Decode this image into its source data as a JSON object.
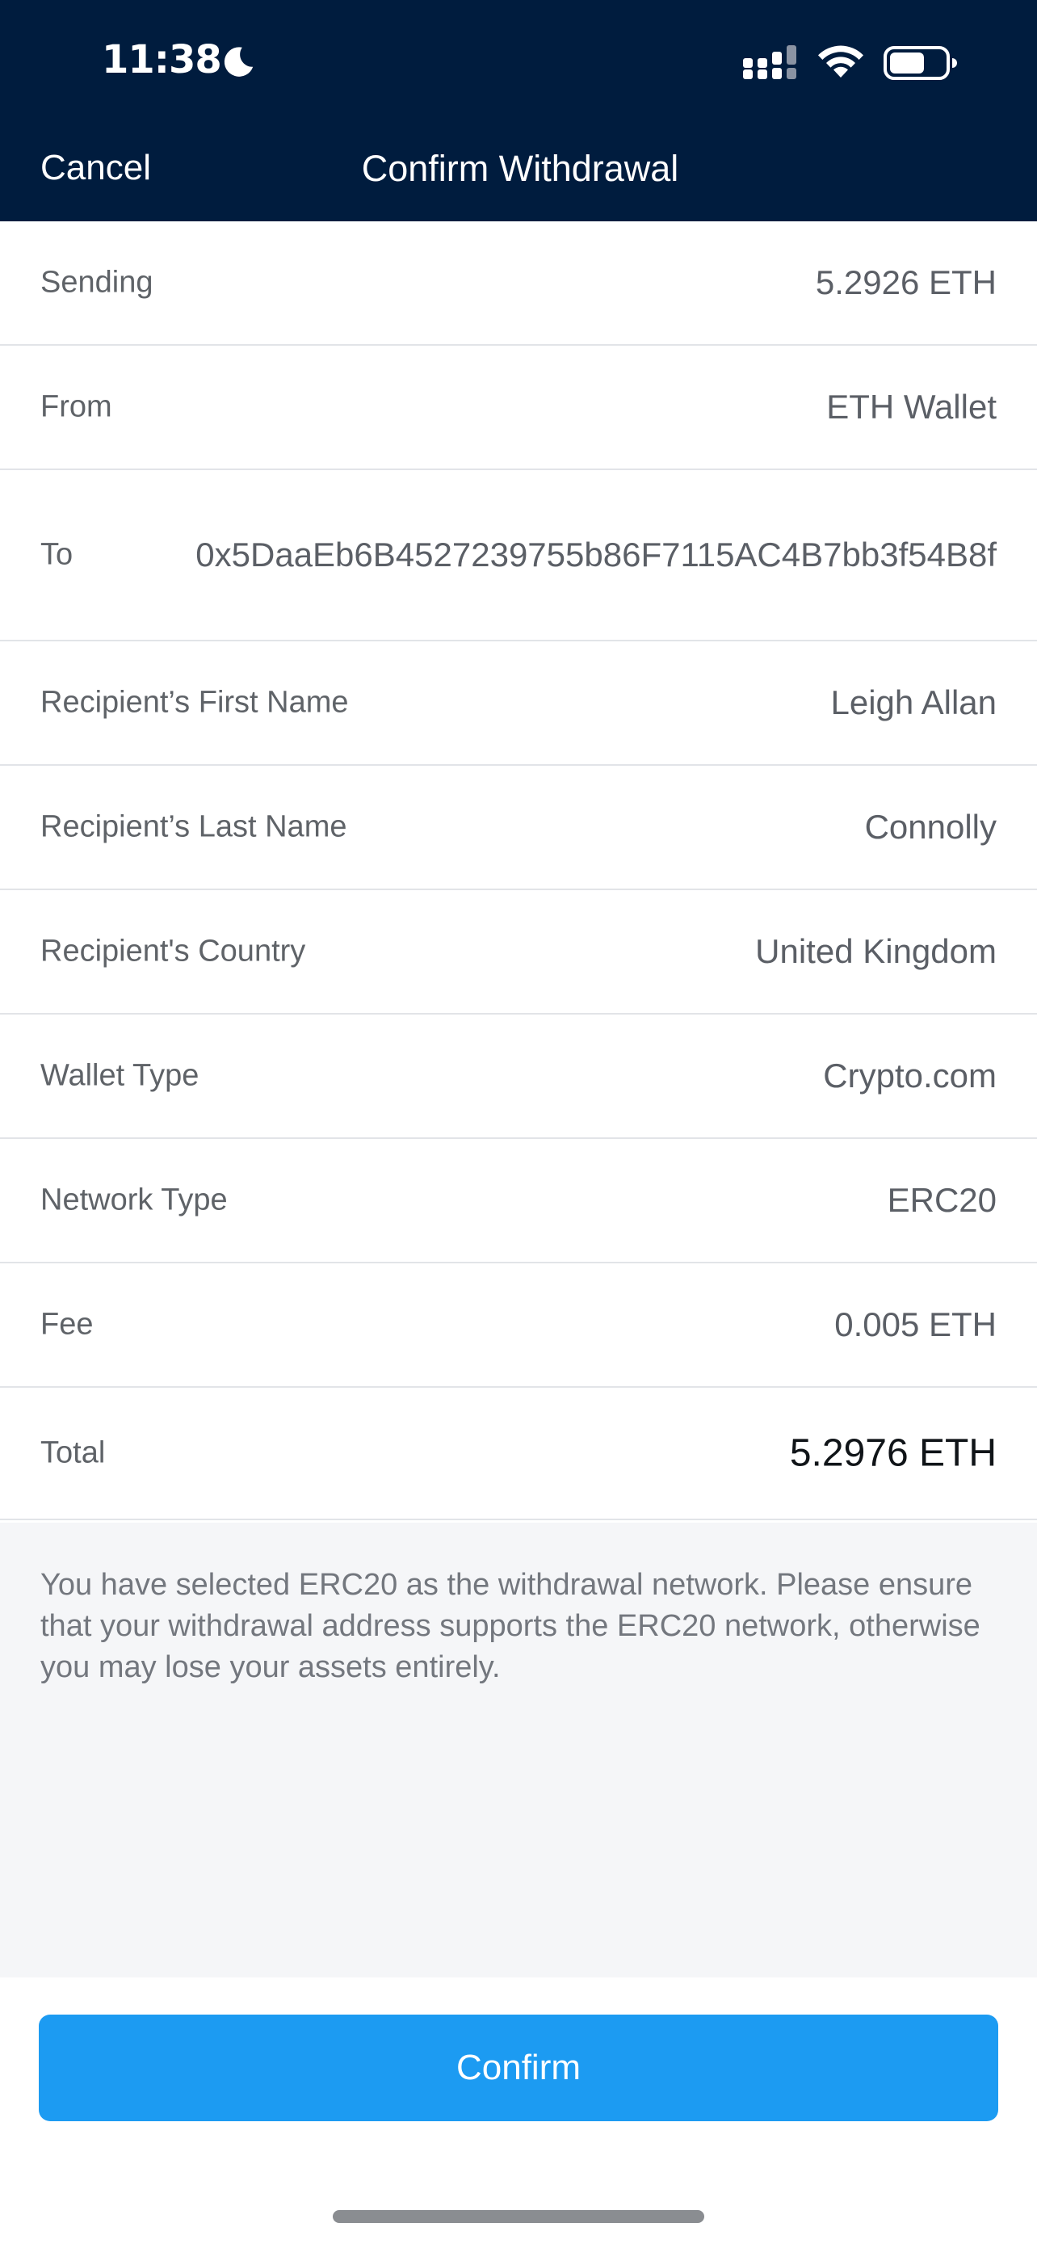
{
  "status_bar": {
    "time": "11:38",
    "icons": [
      "moon-icon",
      "signal-icon",
      "wifi-icon",
      "battery-icon"
    ]
  },
  "nav": {
    "cancel_label": "Cancel",
    "title": "Confirm Withdrawal"
  },
  "rows": [
    {
      "label": "Sending",
      "value": "5.2926 ETH"
    },
    {
      "label": "From",
      "value": "ETH Wallet"
    },
    {
      "label": "To",
      "value": "0x5DaaEb6B4527239755b86F7115AC4B7bb3f54B8f"
    },
    {
      "label": "Recipient’s First Name",
      "value": "Leigh Allan"
    },
    {
      "label": "Recipient’s Last Name",
      "value": "Connolly"
    },
    {
      "label": "Recipient's Country",
      "value": "United Kingdom"
    },
    {
      "label": "Wallet Type",
      "value": "Crypto.com"
    },
    {
      "label": "Network Type",
      "value": "ERC20"
    },
    {
      "label": "Fee",
      "value": "0.005 ETH"
    },
    {
      "label": "Total",
      "value": "5.2976 ETH"
    }
  ],
  "notice": "You have selected ERC20 as the withdrawal network. Please ensure that your withdrawal address supports the ERC20 network, otherwise you may lose your assets entirely.",
  "confirm_label": "Confirm",
  "colors": {
    "header_bg": "#001c3e",
    "accent": "#1c9bf2",
    "notice_bg": "#f5f6f8"
  }
}
